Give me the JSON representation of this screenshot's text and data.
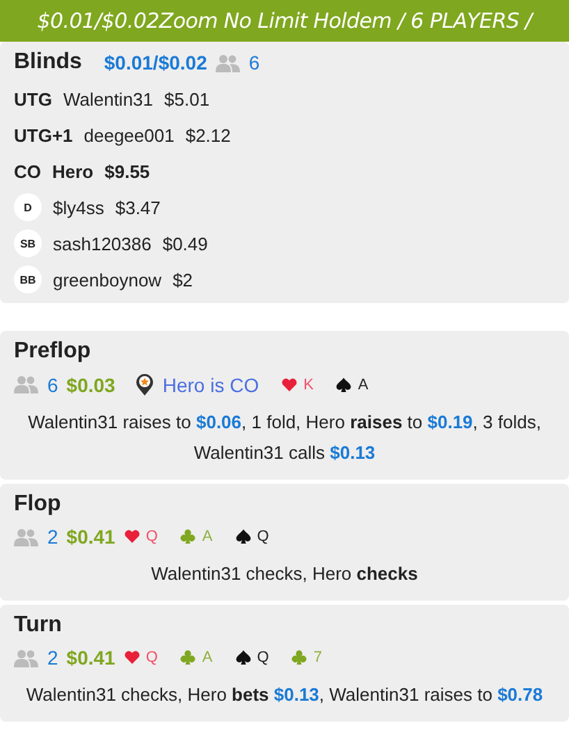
{
  "header": {
    "title": "$0.01/$0.02Zoom No Limit Holdem / 6 PLAYERS /"
  },
  "blinds": {
    "title": "Blinds",
    "stakes": "$0.01/$0.02",
    "players": "6",
    "seats": [
      {
        "kind": "label",
        "position": "UTG",
        "name": "Walentin31",
        "stack": "$5.01",
        "hero": false
      },
      {
        "kind": "label",
        "position": "UTG+1",
        "name": "deegee001",
        "stack": "$2.12",
        "hero": false
      },
      {
        "kind": "label",
        "position": "CO",
        "name": "Hero",
        "stack": "$9.55",
        "hero": true
      },
      {
        "kind": "badge",
        "position": "D",
        "name": "$ly4ss",
        "stack": "$3.47",
        "hero": false
      },
      {
        "kind": "badge",
        "position": "SB",
        "name": "sash120386",
        "stack": "$0.49",
        "hero": false
      },
      {
        "kind": "badge",
        "position": "BB",
        "name": "greenboynow",
        "stack": "$2",
        "hero": false
      }
    ]
  },
  "streets": [
    {
      "title": "Preflop",
      "players": "6",
      "pot": "$0.03",
      "hero_position": "Hero is CO",
      "cards": [
        {
          "kind": "heart",
          "rank": "K"
        },
        {
          "kind": "spade",
          "rank": "A"
        }
      ],
      "action": [
        {
          "kind": "text",
          "text": "Walentin31 raises to "
        },
        {
          "kind": "amount",
          "text": "$0.06"
        },
        {
          "kind": "text",
          "text": ", 1 fold, Hero "
        },
        {
          "kind": "hero",
          "text": "raises"
        },
        {
          "kind": "text",
          "text": " to "
        },
        {
          "kind": "amount",
          "text": "$0.19"
        },
        {
          "kind": "text",
          "text": ", 3 folds, Walentin31 calls "
        },
        {
          "kind": "amount",
          "text": "$0.13"
        }
      ]
    },
    {
      "title": "Flop",
      "players": "2",
      "pot": "$0.41",
      "cards": [
        {
          "kind": "heart",
          "rank": "Q"
        },
        {
          "kind": "club",
          "rank": "A"
        },
        {
          "kind": "spade",
          "rank": "Q"
        }
      ],
      "action": [
        {
          "kind": "text",
          "text": "Walentin31 checks, Hero "
        },
        {
          "kind": "hero",
          "text": "checks"
        }
      ]
    },
    {
      "title": "Turn",
      "players": "2",
      "pot": "$0.41",
      "cards": [
        {
          "kind": "heart",
          "rank": "Q"
        },
        {
          "kind": "club",
          "rank": "A"
        },
        {
          "kind": "spade",
          "rank": "Q"
        },
        {
          "kind": "club",
          "rank": "7"
        }
      ],
      "action": [
        {
          "kind": "text",
          "text": "Walentin31 checks, Hero "
        },
        {
          "kind": "hero",
          "text": "bets"
        },
        {
          "kind": "amount",
          "text": " $0.13"
        },
        {
          "kind": "text",
          "text": ", Walentin31 raises to "
        },
        {
          "kind": "amount",
          "text": "$0.78"
        }
      ]
    }
  ]
}
